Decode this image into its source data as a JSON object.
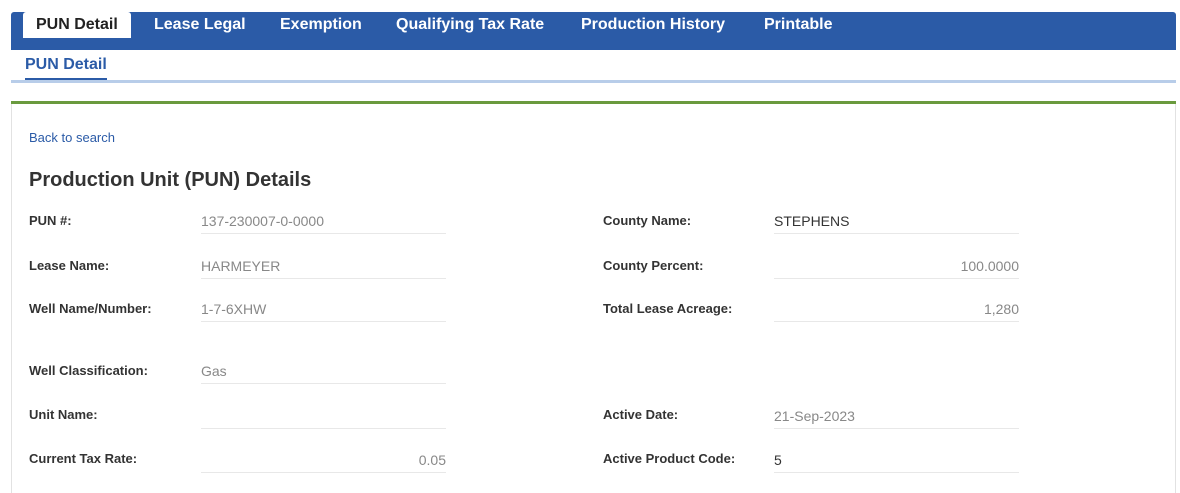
{
  "tabs": [
    "PUN Detail",
    "Lease Legal",
    "Exemption",
    "Qualifying Tax Rate",
    "Production History",
    "Printable"
  ],
  "subtab": "PUN Detail",
  "back_link": "Back to search",
  "title": "Production Unit (PUN) Details",
  "left_fields": [
    {
      "label": "PUN #:",
      "value": "137-230007-0-0000"
    },
    {
      "label": "Lease Name:",
      "value": "HARMEYER"
    },
    {
      "label": "Well Name/Number:",
      "value": "1-7-6XHW"
    },
    {
      "label": "Well Classification:",
      "value": "Gas"
    },
    {
      "label": "Unit Name:",
      "value": ""
    },
    {
      "label": "Current Tax Rate:",
      "value": "0.05"
    }
  ],
  "right_fields": [
    {
      "label": "County Name:",
      "value": "STEPHENS"
    },
    {
      "label": "County Percent:",
      "value": "100.0000"
    },
    {
      "label": "Total Lease Acreage:",
      "value": "1,280"
    },
    {
      "label": "Active Date:",
      "value": "21-Sep-2023"
    },
    {
      "label": "Active Product Code:",
      "value": "5"
    }
  ]
}
